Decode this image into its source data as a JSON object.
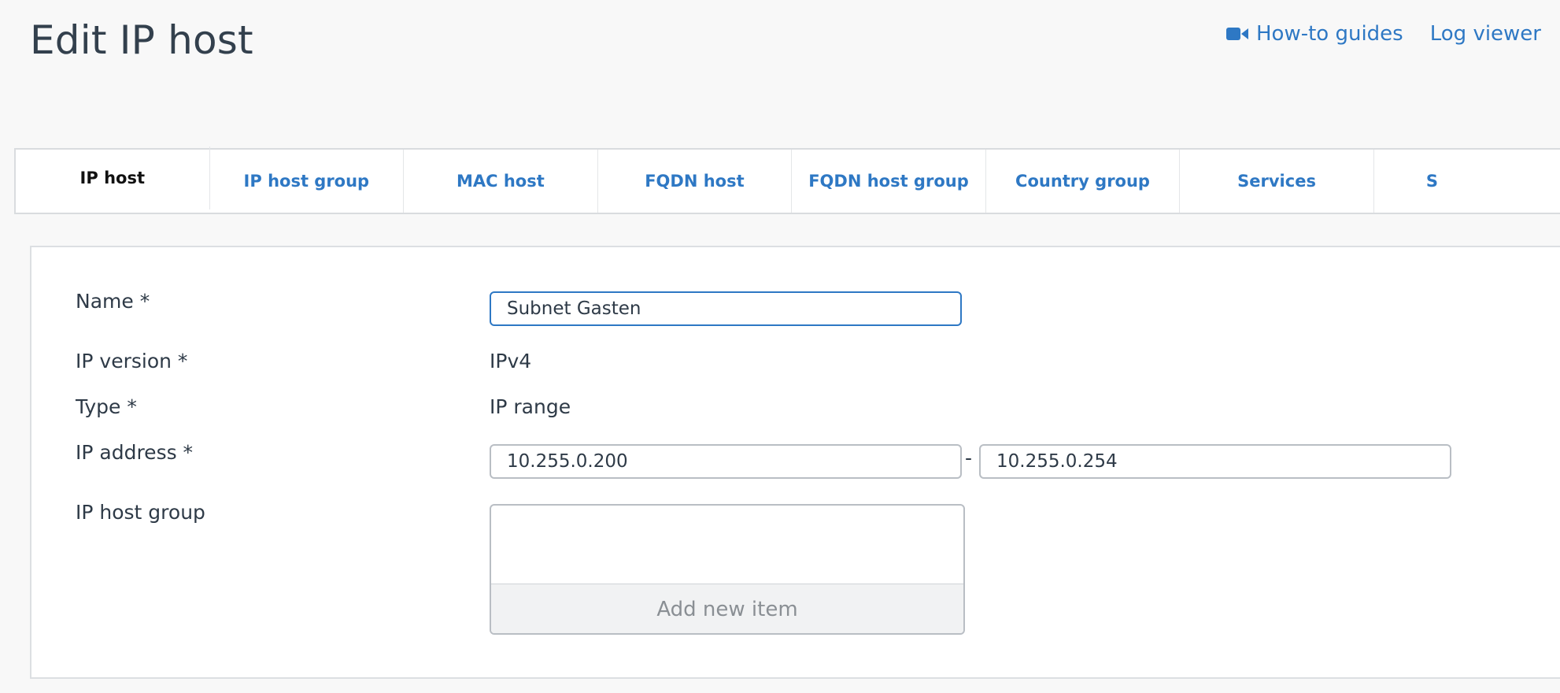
{
  "page": {
    "title": "Edit IP host"
  },
  "header_links": [
    {
      "label": "How-to guides",
      "icon": "video-camera-icon"
    },
    {
      "label": "Log viewer"
    }
  ],
  "tabs": [
    {
      "label": "IP host",
      "active": true
    },
    {
      "label": "IP host group",
      "active": false
    },
    {
      "label": "MAC host",
      "active": false
    },
    {
      "label": "FQDN host",
      "active": false
    },
    {
      "label": "FQDN host group",
      "active": false
    },
    {
      "label": "Country group",
      "active": false
    },
    {
      "label": "Services",
      "active": false
    },
    {
      "label": "S",
      "active": false
    }
  ],
  "form": {
    "name": {
      "label": "Name *",
      "value": "Subnet Gasten"
    },
    "ip_version": {
      "label": "IP version *",
      "value": "IPv4"
    },
    "type": {
      "label": "Type *",
      "value": "IP range"
    },
    "ip_address": {
      "label": "IP address *",
      "start": "10.255.0.200",
      "separator": "-",
      "end": "10.255.0.254"
    },
    "ip_host_group": {
      "label": "IP host group",
      "add_label": "Add new item"
    }
  },
  "colors": {
    "accent": "#2e78c4",
    "text": "#2e3a47",
    "background": "#f8f8f8"
  }
}
